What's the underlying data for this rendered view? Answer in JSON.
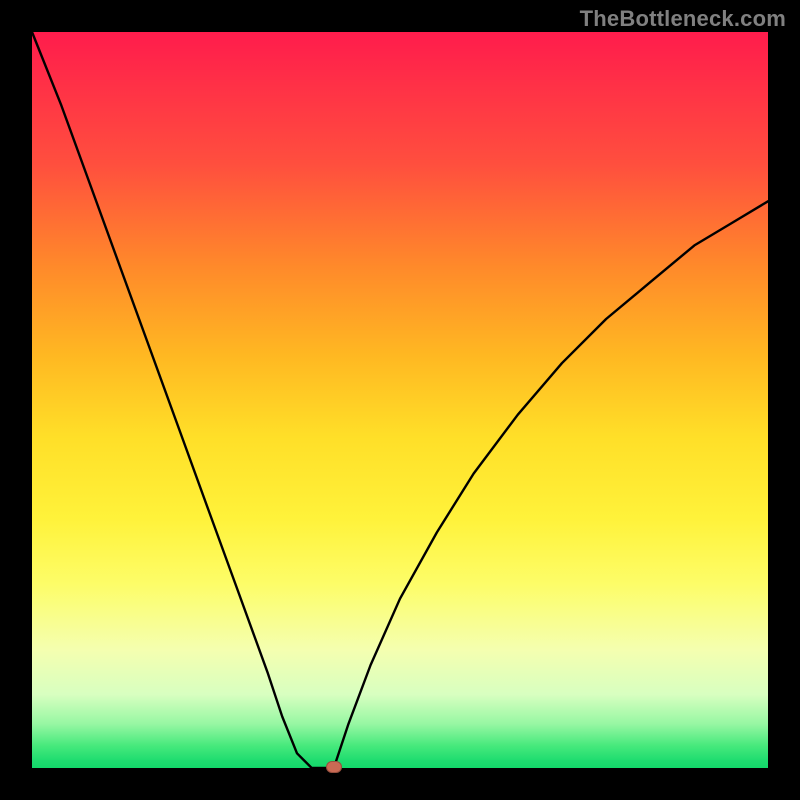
{
  "watermark": "TheBottleneck.com",
  "colors": {
    "frame": "#000000",
    "curve": "#000000",
    "marker": "#c96a54"
  },
  "chart_data": {
    "type": "line",
    "title": "",
    "xlabel": "",
    "ylabel": "",
    "xlim": [
      0,
      100
    ],
    "ylim": [
      0,
      100
    ],
    "grid": false,
    "series": [
      {
        "name": "left-branch",
        "x": [
          0,
          4,
          8,
          12,
          16,
          20,
          24,
          28,
          32,
          34,
          36,
          37,
          38
        ],
        "values": [
          100,
          90,
          79,
          68,
          57,
          46,
          35,
          24,
          13,
          7,
          2,
          1,
          0
        ]
      },
      {
        "name": "floor",
        "x": [
          38,
          40,
          41
        ],
        "values": [
          0,
          0,
          0
        ]
      },
      {
        "name": "right-branch",
        "x": [
          41,
          43,
          46,
          50,
          55,
          60,
          66,
          72,
          78,
          84,
          90,
          95,
          100
        ],
        "values": [
          0,
          6,
          14,
          23,
          32,
          40,
          48,
          55,
          61,
          66,
          71,
          74,
          77
        ]
      }
    ],
    "annotations": [
      {
        "name": "marker",
        "x": 41,
        "y": 0
      }
    ]
  }
}
